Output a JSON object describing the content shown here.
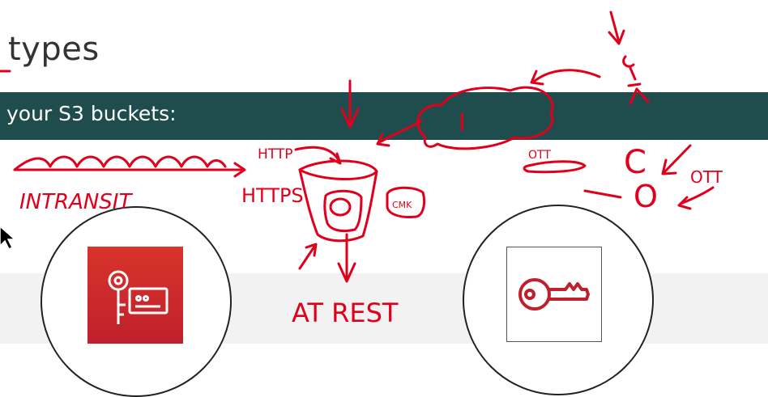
{
  "slide": {
    "title": "types",
    "banner_text": "your S3 buckets:"
  },
  "annotations": {
    "in_transit": "INTRANSIT",
    "http": "HTTP",
    "https": "HTTPS",
    "at_rest": "AT REST",
    "cmk": "CMK",
    "ott_top": "OTT",
    "ott_right": "OTT",
    "letter_i": "I",
    "letter_c": "C",
    "letter_o": "O"
  },
  "icons": {
    "left": "key-card-icon",
    "right": "key-icon"
  },
  "colors": {
    "banner": "#1f4d4e",
    "ink": "#e0001b",
    "tile_red": "#c0202c"
  }
}
